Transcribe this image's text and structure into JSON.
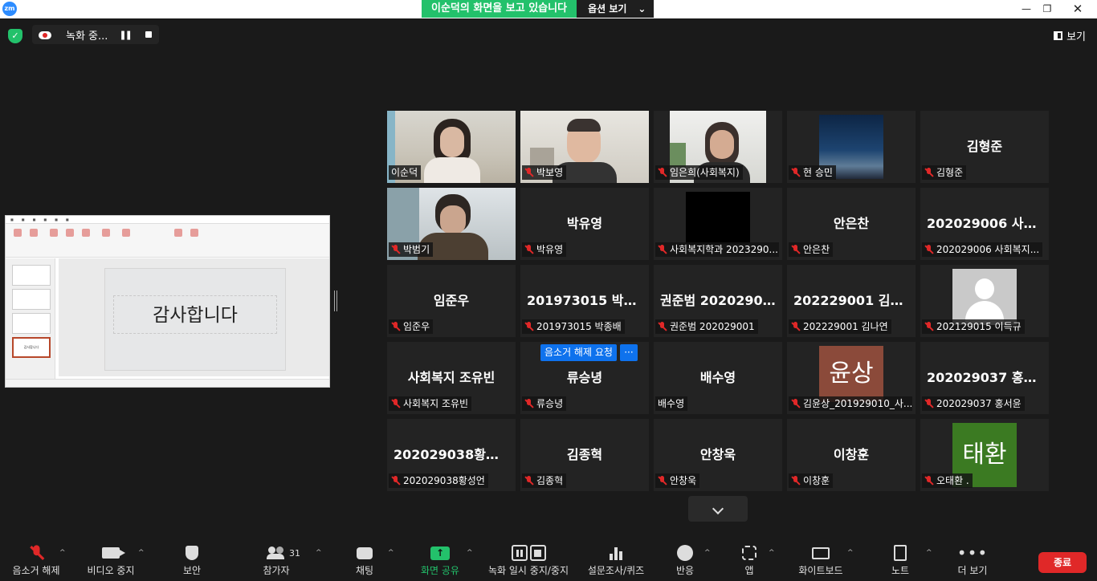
{
  "app": {
    "logo": "zm"
  },
  "banner": {
    "viewing": "이순덕의 화면을 보고 있습니다",
    "options": "옵션 보기"
  },
  "recording": {
    "label": "녹화 중..."
  },
  "view_button": "보기",
  "slide": {
    "title": "감사합니다"
  },
  "participants": [
    {
      "big": "",
      "label": "이순덕",
      "muted": false,
      "video": "photo-1",
      "active": true
    },
    {
      "big": "",
      "label": "박보영",
      "muted": true,
      "video": "photo-2"
    },
    {
      "big": "",
      "label": "임은희(사회복지)",
      "muted": true,
      "video": "photo-3"
    },
    {
      "big": "",
      "label": "현 승민",
      "muted": true,
      "video": "night-sky"
    },
    {
      "big": "김형준",
      "label": "김형준",
      "muted": true
    },
    {
      "big": "",
      "label": "박범기",
      "muted": true,
      "video": "photo-4"
    },
    {
      "big": "박유영",
      "label": "박유영",
      "muted": true
    },
    {
      "big": "",
      "label": "사회복지학과 2023290...",
      "muted": true,
      "video": "black"
    },
    {
      "big": "안은찬",
      "label": "안은찬",
      "muted": true
    },
    {
      "big": "202029006 사회복지...",
      "label": "202029006 사회복지...",
      "muted": true
    },
    {
      "big": "임준우",
      "label": "임준우",
      "muted": true
    },
    {
      "big": "201973015 박종배",
      "label": "201973015 박종배",
      "muted": true
    },
    {
      "big": "권준범 202029001",
      "label": "권준범 202029001",
      "muted": true
    },
    {
      "big": "202229001 김나연",
      "label": "202229001 김나연",
      "muted": true
    },
    {
      "big": "",
      "label": "202129015 이득규",
      "muted": true,
      "video": "avatar-default"
    },
    {
      "big": "사회복지 조유빈",
      "label": "사회복지 조유빈",
      "muted": true
    },
    {
      "big": "류승녕",
      "label": "류승녕",
      "muted": true
    },
    {
      "big": "배수영",
      "label": "배수영",
      "muted": false
    },
    {
      "big": "",
      "label": "김윤상_201929010_사...",
      "muted": true,
      "video": "avatar-윤상"
    },
    {
      "big": "202029037 홍서윤",
      "label": "202029037 홍서윤",
      "muted": true
    },
    {
      "big": "202029038황성언",
      "label": "202029038황성언",
      "muted": true
    },
    {
      "big": "김종혁",
      "label": "김종혁",
      "muted": true
    },
    {
      "big": "안창욱",
      "label": "안창욱",
      "muted": true
    },
    {
      "big": "이창훈",
      "label": "이창훈",
      "muted": true
    },
    {
      "big": "",
      "label": "오태환 .",
      "muted": true,
      "video": "avatar-태환"
    }
  ],
  "avatar_text": {
    "yunsang": "윤상",
    "taehwan": "태환"
  },
  "unmute_request": {
    "label": "음소거 해제 요청",
    "more": "···"
  },
  "toolbar": {
    "unmute": "음소거 해제",
    "video": "비디오 중지",
    "security": "보안",
    "participants": "참가자",
    "participants_count": "31",
    "chat": "채팅",
    "share": "화면 공유",
    "record": "녹화 일시 중지/중지",
    "polls": "설문조사/퀴즈",
    "reactions": "반응",
    "apps": "앱",
    "whiteboard": "화이트보드",
    "notes": "노트",
    "more": "더 보기",
    "end": "종료"
  },
  "colors": {
    "active_border": "#d9eb6f",
    "share_green": "#23c16b",
    "end_red": "#e02828",
    "zoom_blue": "#0e72ed"
  }
}
